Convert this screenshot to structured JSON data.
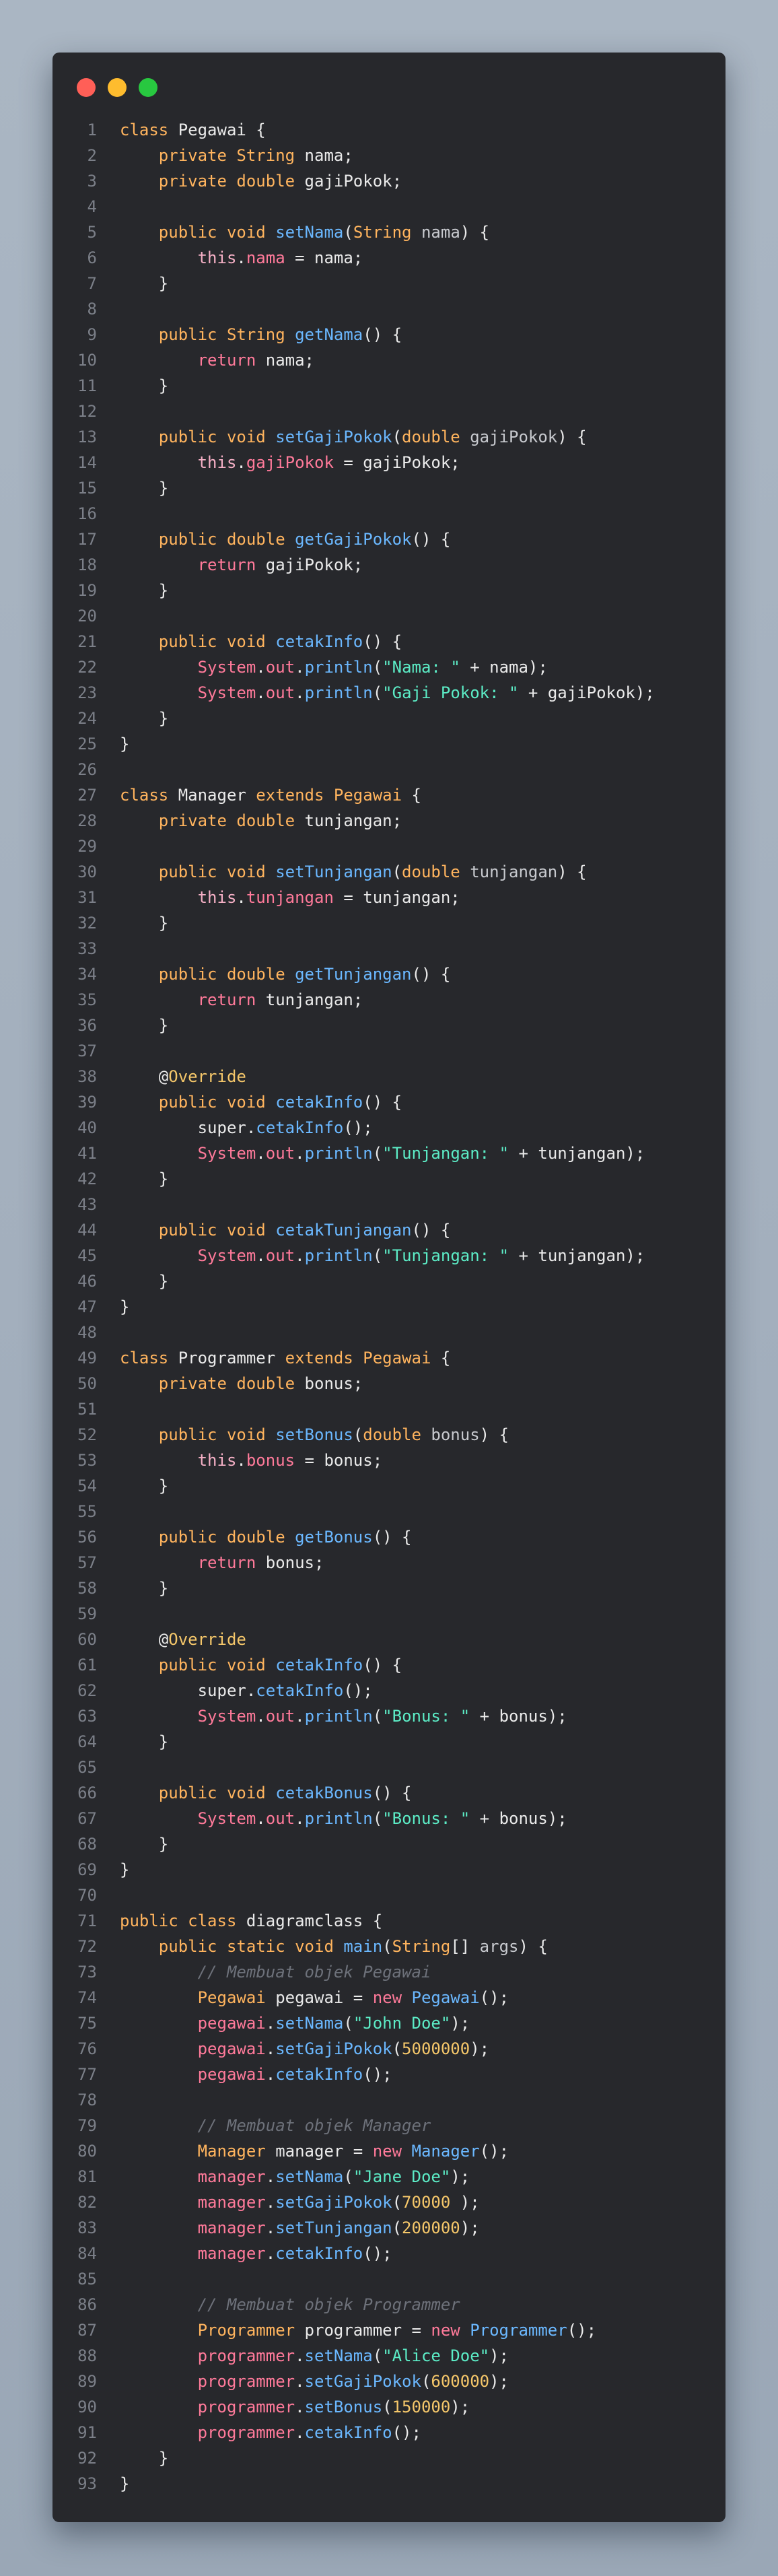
{
  "window": {
    "controls": [
      "close",
      "minimize",
      "maximize"
    ]
  },
  "colors": {
    "window_bg": "#27282c",
    "keyword": "#ffb45e",
    "function": "#6bb8ff",
    "string": "#5cecc6",
    "number": "#f5c76a",
    "field": "#ff7a9a",
    "comment": "#6d717a",
    "line_number": "#7b7f88"
  },
  "code": [
    [
      [
        "kw",
        "class"
      ],
      [
        "txt",
        " Pegawai {"
      ]
    ],
    [
      [
        "txt",
        "    "
      ],
      [
        "kw",
        "private"
      ],
      [
        "txt",
        " "
      ],
      [
        "ty",
        "String"
      ],
      [
        "txt",
        " nama;"
      ]
    ],
    [
      [
        "txt",
        "    "
      ],
      [
        "kw",
        "private"
      ],
      [
        "txt",
        " "
      ],
      [
        "kw",
        "double"
      ],
      [
        "txt",
        " gajiPokok;"
      ]
    ],
    [],
    [
      [
        "txt",
        "    "
      ],
      [
        "kw",
        "public"
      ],
      [
        "txt",
        " "
      ],
      [
        "kw",
        "void"
      ],
      [
        "txt",
        " "
      ],
      [
        "fn",
        "setNama"
      ],
      [
        "txt",
        "("
      ],
      [
        "ty",
        "String"
      ],
      [
        "txt",
        " "
      ],
      [
        "par",
        "nama"
      ],
      [
        "txt",
        ") {"
      ]
    ],
    [
      [
        "txt",
        "        "
      ],
      [
        "this",
        "this"
      ],
      [
        "txt",
        "."
      ],
      [
        "fld",
        "nama"
      ],
      [
        "txt",
        " = nama;"
      ]
    ],
    [
      [
        "txt",
        "    }"
      ]
    ],
    [],
    [
      [
        "txt",
        "    "
      ],
      [
        "kw",
        "public"
      ],
      [
        "txt",
        " "
      ],
      [
        "ty",
        "String"
      ],
      [
        "txt",
        " "
      ],
      [
        "fn",
        "getNama"
      ],
      [
        "txt",
        "() {"
      ]
    ],
    [
      [
        "txt",
        "        "
      ],
      [
        "fld",
        "return"
      ],
      [
        "txt",
        " nama;"
      ]
    ],
    [
      [
        "txt",
        "    }"
      ]
    ],
    [],
    [
      [
        "txt",
        "    "
      ],
      [
        "kw",
        "public"
      ],
      [
        "txt",
        " "
      ],
      [
        "kw",
        "void"
      ],
      [
        "txt",
        " "
      ],
      [
        "fn",
        "setGajiPokok"
      ],
      [
        "txt",
        "("
      ],
      [
        "kw",
        "double"
      ],
      [
        "txt",
        " "
      ],
      [
        "par",
        "gajiPokok"
      ],
      [
        "txt",
        ") {"
      ]
    ],
    [
      [
        "txt",
        "        "
      ],
      [
        "this",
        "this"
      ],
      [
        "txt",
        "."
      ],
      [
        "fld",
        "gajiPokok"
      ],
      [
        "txt",
        " = gajiPokok;"
      ]
    ],
    [
      [
        "txt",
        "    }"
      ]
    ],
    [],
    [
      [
        "txt",
        "    "
      ],
      [
        "kw",
        "public"
      ],
      [
        "txt",
        " "
      ],
      [
        "kw",
        "double"
      ],
      [
        "txt",
        " "
      ],
      [
        "fn",
        "getGajiPokok"
      ],
      [
        "txt",
        "() {"
      ]
    ],
    [
      [
        "txt",
        "        "
      ],
      [
        "fld",
        "return"
      ],
      [
        "txt",
        " gajiPokok;"
      ]
    ],
    [
      [
        "txt",
        "    }"
      ]
    ],
    [],
    [
      [
        "txt",
        "    "
      ],
      [
        "kw",
        "public"
      ],
      [
        "txt",
        " "
      ],
      [
        "kw",
        "void"
      ],
      [
        "txt",
        " "
      ],
      [
        "fn",
        "cetakInfo"
      ],
      [
        "txt",
        "() {"
      ]
    ],
    [
      [
        "txt",
        "        "
      ],
      [
        "sys",
        "System"
      ],
      [
        "txt",
        "."
      ],
      [
        "sys",
        "out"
      ],
      [
        "txt",
        "."
      ],
      [
        "fn",
        "println"
      ],
      [
        "txt",
        "("
      ],
      [
        "str",
        "\"Nama: \""
      ],
      [
        "txt",
        " + nama);"
      ]
    ],
    [
      [
        "txt",
        "        "
      ],
      [
        "sys",
        "System"
      ],
      [
        "txt",
        "."
      ],
      [
        "sys",
        "out"
      ],
      [
        "txt",
        "."
      ],
      [
        "fn",
        "println"
      ],
      [
        "txt",
        "("
      ],
      [
        "str",
        "\"Gaji Pokok: \""
      ],
      [
        "txt",
        " + gajiPokok);"
      ]
    ],
    [
      [
        "txt",
        "    }"
      ]
    ],
    [
      [
        "txt",
        "}"
      ]
    ],
    [],
    [
      [
        "kw",
        "class"
      ],
      [
        "txt",
        " Manager "
      ],
      [
        "kw",
        "extends"
      ],
      [
        "txt",
        " "
      ],
      [
        "ty",
        "Pegawai"
      ],
      [
        "txt",
        " {"
      ]
    ],
    [
      [
        "txt",
        "    "
      ],
      [
        "kw",
        "private"
      ],
      [
        "txt",
        " "
      ],
      [
        "kw",
        "double"
      ],
      [
        "txt",
        " tunjangan;"
      ]
    ],
    [],
    [
      [
        "txt",
        "    "
      ],
      [
        "kw",
        "public"
      ],
      [
        "txt",
        " "
      ],
      [
        "kw",
        "void"
      ],
      [
        "txt",
        " "
      ],
      [
        "fn",
        "setTunjangan"
      ],
      [
        "txt",
        "("
      ],
      [
        "kw",
        "double"
      ],
      [
        "txt",
        " "
      ],
      [
        "par",
        "tunjangan"
      ],
      [
        "txt",
        ") {"
      ]
    ],
    [
      [
        "txt",
        "        "
      ],
      [
        "this",
        "this"
      ],
      [
        "txt",
        "."
      ],
      [
        "fld",
        "tunjangan"
      ],
      [
        "txt",
        " = tunjangan;"
      ]
    ],
    [
      [
        "txt",
        "    }"
      ]
    ],
    [],
    [
      [
        "txt",
        "    "
      ],
      [
        "kw",
        "public"
      ],
      [
        "txt",
        " "
      ],
      [
        "kw",
        "double"
      ],
      [
        "txt",
        " "
      ],
      [
        "fn",
        "getTunjangan"
      ],
      [
        "txt",
        "() {"
      ]
    ],
    [
      [
        "txt",
        "        "
      ],
      [
        "fld",
        "return"
      ],
      [
        "txt",
        " tunjangan;"
      ]
    ],
    [
      [
        "txt",
        "    }"
      ]
    ],
    [],
    [
      [
        "txt",
        "    @"
      ],
      [
        "ann",
        "Override"
      ]
    ],
    [
      [
        "txt",
        "    "
      ],
      [
        "kw",
        "public"
      ],
      [
        "txt",
        " "
      ],
      [
        "kw",
        "void"
      ],
      [
        "txt",
        " "
      ],
      [
        "fn",
        "cetakInfo"
      ],
      [
        "txt",
        "() {"
      ]
    ],
    [
      [
        "txt",
        "        super."
      ],
      [
        "fn",
        "cetakInfo"
      ],
      [
        "txt",
        "();"
      ]
    ],
    [
      [
        "txt",
        "        "
      ],
      [
        "sys",
        "System"
      ],
      [
        "txt",
        "."
      ],
      [
        "sys",
        "out"
      ],
      [
        "txt",
        "."
      ],
      [
        "fn",
        "println"
      ],
      [
        "txt",
        "("
      ],
      [
        "str",
        "\"Tunjangan: \""
      ],
      [
        "txt",
        " + tunjangan);"
      ]
    ],
    [
      [
        "txt",
        "    }"
      ]
    ],
    [],
    [
      [
        "txt",
        "    "
      ],
      [
        "kw",
        "public"
      ],
      [
        "txt",
        " "
      ],
      [
        "kw",
        "void"
      ],
      [
        "txt",
        " "
      ],
      [
        "fn",
        "cetakTunjangan"
      ],
      [
        "txt",
        "() {"
      ]
    ],
    [
      [
        "txt",
        "        "
      ],
      [
        "sys",
        "System"
      ],
      [
        "txt",
        "."
      ],
      [
        "sys",
        "out"
      ],
      [
        "txt",
        "."
      ],
      [
        "fn",
        "println"
      ],
      [
        "txt",
        "("
      ],
      [
        "str",
        "\"Tunjangan: \""
      ],
      [
        "txt",
        " + tunjangan);"
      ]
    ],
    [
      [
        "txt",
        "    }"
      ]
    ],
    [
      [
        "txt",
        "}"
      ]
    ],
    [],
    [
      [
        "kw",
        "class"
      ],
      [
        "txt",
        " Programmer "
      ],
      [
        "kw",
        "extends"
      ],
      [
        "txt",
        " "
      ],
      [
        "ty",
        "Pegawai"
      ],
      [
        "txt",
        " {"
      ]
    ],
    [
      [
        "txt",
        "    "
      ],
      [
        "kw",
        "private"
      ],
      [
        "txt",
        " "
      ],
      [
        "kw",
        "double"
      ],
      [
        "txt",
        " bonus;"
      ]
    ],
    [],
    [
      [
        "txt",
        "    "
      ],
      [
        "kw",
        "public"
      ],
      [
        "txt",
        " "
      ],
      [
        "kw",
        "void"
      ],
      [
        "txt",
        " "
      ],
      [
        "fn",
        "setBonus"
      ],
      [
        "txt",
        "("
      ],
      [
        "kw",
        "double"
      ],
      [
        "txt",
        " "
      ],
      [
        "par",
        "bonus"
      ],
      [
        "txt",
        ") {"
      ]
    ],
    [
      [
        "txt",
        "        "
      ],
      [
        "this",
        "this"
      ],
      [
        "txt",
        "."
      ],
      [
        "fld",
        "bonus"
      ],
      [
        "txt",
        " = bonus;"
      ]
    ],
    [
      [
        "txt",
        "    }"
      ]
    ],
    [],
    [
      [
        "txt",
        "    "
      ],
      [
        "kw",
        "public"
      ],
      [
        "txt",
        " "
      ],
      [
        "kw",
        "double"
      ],
      [
        "txt",
        " "
      ],
      [
        "fn",
        "getBonus"
      ],
      [
        "txt",
        "() {"
      ]
    ],
    [
      [
        "txt",
        "        "
      ],
      [
        "fld",
        "return"
      ],
      [
        "txt",
        " bonus;"
      ]
    ],
    [
      [
        "txt",
        "    }"
      ]
    ],
    [],
    [
      [
        "txt",
        "    @"
      ],
      [
        "ann",
        "Override"
      ]
    ],
    [
      [
        "txt",
        "    "
      ],
      [
        "kw",
        "public"
      ],
      [
        "txt",
        " "
      ],
      [
        "kw",
        "void"
      ],
      [
        "txt",
        " "
      ],
      [
        "fn",
        "cetakInfo"
      ],
      [
        "txt",
        "() {"
      ]
    ],
    [
      [
        "txt",
        "        super."
      ],
      [
        "fn",
        "cetakInfo"
      ],
      [
        "txt",
        "();"
      ]
    ],
    [
      [
        "txt",
        "        "
      ],
      [
        "sys",
        "System"
      ],
      [
        "txt",
        "."
      ],
      [
        "sys",
        "out"
      ],
      [
        "txt",
        "."
      ],
      [
        "fn",
        "println"
      ],
      [
        "txt",
        "("
      ],
      [
        "str",
        "\"Bonus: \""
      ],
      [
        "txt",
        " + bonus);"
      ]
    ],
    [
      [
        "txt",
        "    }"
      ]
    ],
    [],
    [
      [
        "txt",
        "    "
      ],
      [
        "kw",
        "public"
      ],
      [
        "txt",
        " "
      ],
      [
        "kw",
        "void"
      ],
      [
        "txt",
        " "
      ],
      [
        "fn",
        "cetakBonus"
      ],
      [
        "txt",
        "() {"
      ]
    ],
    [
      [
        "txt",
        "        "
      ],
      [
        "sys",
        "System"
      ],
      [
        "txt",
        "."
      ],
      [
        "sys",
        "out"
      ],
      [
        "txt",
        "."
      ],
      [
        "fn",
        "println"
      ],
      [
        "txt",
        "("
      ],
      [
        "str",
        "\"Bonus: \""
      ],
      [
        "txt",
        " + bonus);"
      ]
    ],
    [
      [
        "txt",
        "    }"
      ]
    ],
    [
      [
        "txt",
        "}"
      ]
    ],
    [],
    [
      [
        "kw",
        "public"
      ],
      [
        "txt",
        " "
      ],
      [
        "kw",
        "class"
      ],
      [
        "txt",
        " diagramclass {"
      ]
    ],
    [
      [
        "txt",
        "    "
      ],
      [
        "kw",
        "public"
      ],
      [
        "txt",
        " "
      ],
      [
        "kw",
        "static"
      ],
      [
        "txt",
        " "
      ],
      [
        "kw",
        "void"
      ],
      [
        "txt",
        " "
      ],
      [
        "fn",
        "main"
      ],
      [
        "txt",
        "("
      ],
      [
        "ty",
        "String"
      ],
      [
        "txt",
        "[] "
      ],
      [
        "par",
        "args"
      ],
      [
        "txt",
        ") {"
      ]
    ],
    [
      [
        "txt",
        "        "
      ],
      [
        "cm",
        "// Membuat objek Pegawai"
      ]
    ],
    [
      [
        "txt",
        "        "
      ],
      [
        "ty",
        "Pegawai"
      ],
      [
        "txt",
        " pegawai = "
      ],
      [
        "fld",
        "new"
      ],
      [
        "txt",
        " "
      ],
      [
        "fn",
        "Pegawai"
      ],
      [
        "txt",
        "();"
      ]
    ],
    [
      [
        "txt",
        "        "
      ],
      [
        "obj",
        "pegawai"
      ],
      [
        "txt",
        "."
      ],
      [
        "fn",
        "setNama"
      ],
      [
        "txt",
        "("
      ],
      [
        "str",
        "\"John Doe\""
      ],
      [
        "txt",
        ");"
      ]
    ],
    [
      [
        "txt",
        "        "
      ],
      [
        "obj",
        "pegawai"
      ],
      [
        "txt",
        "."
      ],
      [
        "fn",
        "setGajiPokok"
      ],
      [
        "txt",
        "("
      ],
      [
        "num",
        "5000000"
      ],
      [
        "txt",
        ");"
      ]
    ],
    [
      [
        "txt",
        "        "
      ],
      [
        "obj",
        "pegawai"
      ],
      [
        "txt",
        "."
      ],
      [
        "fn",
        "cetakInfo"
      ],
      [
        "txt",
        "();"
      ]
    ],
    [],
    [
      [
        "txt",
        "        "
      ],
      [
        "cm",
        "// Membuat objek Manager"
      ]
    ],
    [
      [
        "txt",
        "        "
      ],
      [
        "ty",
        "Manager"
      ],
      [
        "txt",
        " manager = "
      ],
      [
        "fld",
        "new"
      ],
      [
        "txt",
        " "
      ],
      [
        "fn",
        "Manager"
      ],
      [
        "txt",
        "();"
      ]
    ],
    [
      [
        "txt",
        "        "
      ],
      [
        "obj",
        "manager"
      ],
      [
        "txt",
        "."
      ],
      [
        "fn",
        "setNama"
      ],
      [
        "txt",
        "("
      ],
      [
        "str",
        "\"Jane Doe\""
      ],
      [
        "txt",
        ");"
      ]
    ],
    [
      [
        "txt",
        "        "
      ],
      [
        "obj",
        "manager"
      ],
      [
        "txt",
        "."
      ],
      [
        "fn",
        "setGajiPokok"
      ],
      [
        "txt",
        "("
      ],
      [
        "num",
        "70000"
      ],
      [
        "txt",
        " );"
      ]
    ],
    [
      [
        "txt",
        "        "
      ],
      [
        "obj",
        "manager"
      ],
      [
        "txt",
        "."
      ],
      [
        "fn",
        "setTunjangan"
      ],
      [
        "txt",
        "("
      ],
      [
        "num",
        "200000"
      ],
      [
        "txt",
        ");"
      ]
    ],
    [
      [
        "txt",
        "        "
      ],
      [
        "obj",
        "manager"
      ],
      [
        "txt",
        "."
      ],
      [
        "fn",
        "cetakInfo"
      ],
      [
        "txt",
        "();"
      ]
    ],
    [],
    [
      [
        "txt",
        "        "
      ],
      [
        "cm",
        "// Membuat objek Programmer"
      ]
    ],
    [
      [
        "txt",
        "        "
      ],
      [
        "ty",
        "Programmer"
      ],
      [
        "txt",
        " programmer = "
      ],
      [
        "fld",
        "new"
      ],
      [
        "txt",
        " "
      ],
      [
        "fn",
        "Programmer"
      ],
      [
        "txt",
        "();"
      ]
    ],
    [
      [
        "txt",
        "        "
      ],
      [
        "obj",
        "programmer"
      ],
      [
        "txt",
        "."
      ],
      [
        "fn",
        "setNama"
      ],
      [
        "txt",
        "("
      ],
      [
        "str",
        "\"Alice Doe\""
      ],
      [
        "txt",
        ");"
      ]
    ],
    [
      [
        "txt",
        "        "
      ],
      [
        "obj",
        "programmer"
      ],
      [
        "txt",
        "."
      ],
      [
        "fn",
        "setGajiPokok"
      ],
      [
        "txt",
        "("
      ],
      [
        "num",
        "600000"
      ],
      [
        "txt",
        ");"
      ]
    ],
    [
      [
        "txt",
        "        "
      ],
      [
        "obj",
        "programmer"
      ],
      [
        "txt",
        "."
      ],
      [
        "fn",
        "setBonus"
      ],
      [
        "txt",
        "("
      ],
      [
        "num",
        "150000"
      ],
      [
        "txt",
        ");"
      ]
    ],
    [
      [
        "txt",
        "        "
      ],
      [
        "obj",
        "programmer"
      ],
      [
        "txt",
        "."
      ],
      [
        "fn",
        "cetakInfo"
      ],
      [
        "txt",
        "();"
      ]
    ],
    [
      [
        "txt",
        "    }"
      ]
    ],
    [
      [
        "txt",
        "}"
      ]
    ]
  ]
}
